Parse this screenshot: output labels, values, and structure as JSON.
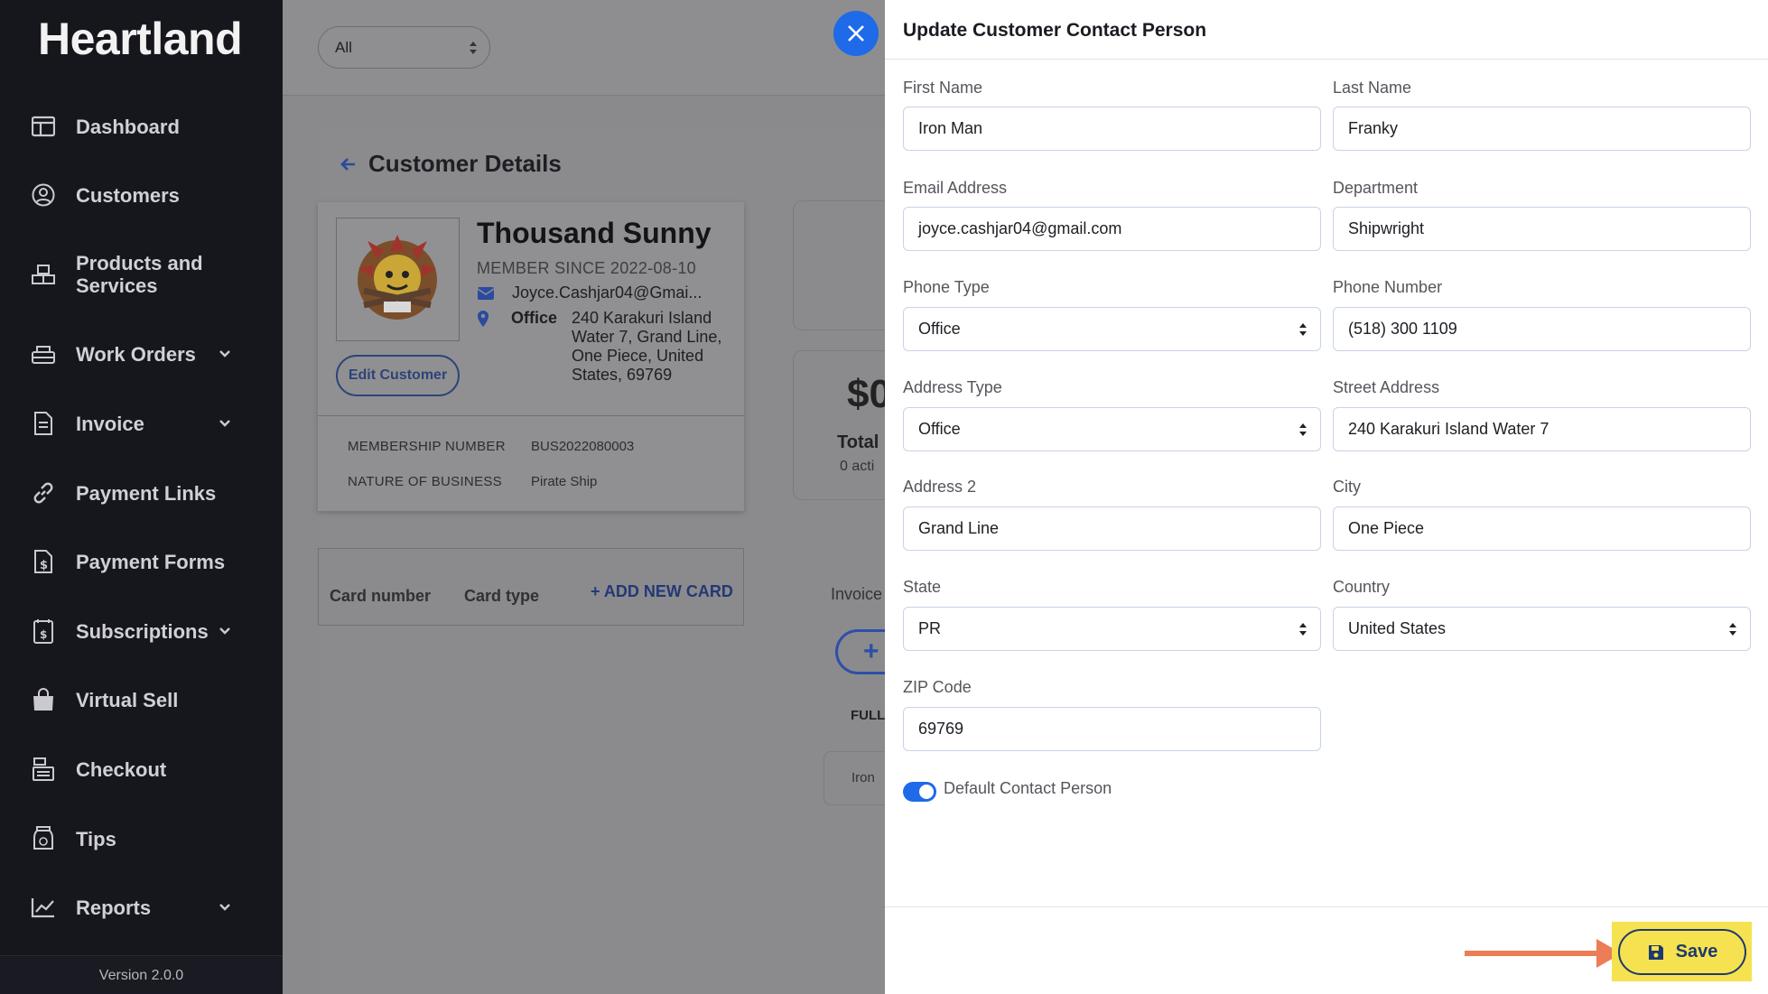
{
  "brand": "Heartland",
  "version": "Version 2.0.0",
  "sidebar": {
    "items": [
      {
        "label": "Dashboard",
        "icon": "dashboard-icon"
      },
      {
        "label": "Customers",
        "icon": "user-icon"
      },
      {
        "label": "Products and Services",
        "icon": "boxes-icon"
      },
      {
        "label": "Work Orders",
        "icon": "work-orders-icon"
      },
      {
        "label": "Invoice",
        "icon": "invoice-icon"
      },
      {
        "label": "Payment Links",
        "icon": "link-icon"
      },
      {
        "label": "Payment Forms",
        "icon": "payment-form-icon"
      },
      {
        "label": "Subscriptions",
        "icon": "subscriptions-icon"
      },
      {
        "label": "Virtual Sell",
        "icon": "bag-icon"
      },
      {
        "label": "Checkout",
        "icon": "register-icon"
      },
      {
        "label": "Tips",
        "icon": "tip-jar-icon"
      },
      {
        "label": "Reports",
        "icon": "chart-icon"
      }
    ]
  },
  "topbar": {
    "filter_value": "All"
  },
  "customer": {
    "page_title": "Customer Details",
    "name": "Thousand Sunny",
    "member_since": "MEMBER SINCE 2022-08-10",
    "email": "Joyce.Cashjar04@Gmai...",
    "address_label": "Office",
    "address": "240 Karakuri Island Water 7, Grand Line, One Piece, United States, 69769",
    "edit_label": "Edit Customer",
    "membership_label": "MEMBERSHIP NUMBER",
    "membership_value": "BUS2022080003",
    "nature_label": "NATURE OF BUSINESS",
    "nature_value": "Pirate Ship"
  },
  "cards": {
    "col_number": "Card number",
    "col_type": "Card type",
    "add_label": "+ ADD NEW CARD"
  },
  "background": {
    "dollar": "$0",
    "total": "Total",
    "active": "0 acti",
    "invoice_tab": "Invoice",
    "plus": "+",
    "full": "FULL",
    "iron": "Iron"
  },
  "modal": {
    "title": "Update Customer Contact Person",
    "first_name_label": "First Name",
    "first_name": "Iron Man",
    "last_name_label": "Last Name",
    "last_name": "Franky",
    "email_label": "Email Address",
    "email": "joyce.cashjar04@gmail.com",
    "department_label": "Department",
    "department": "Shipwright",
    "phone_type_label": "Phone Type",
    "phone_type": "Office",
    "phone_number_label": "Phone Number",
    "phone_number": "(518) 300 1109",
    "address_type_label": "Address Type",
    "address_type": "Office",
    "street_label": "Street Address",
    "street": "240 Karakuri Island Water 7",
    "address2_label": "Address 2",
    "address2": "Grand Line",
    "city_label": "City",
    "city": "One Piece",
    "state_label": "State",
    "state": "PR",
    "country_label": "Country",
    "country": "United States",
    "zip_label": "ZIP Code",
    "zip": "69769",
    "default_label": "Default Contact Person",
    "default_on": true,
    "save_label": "Save"
  },
  "colors": {
    "accent": "#1e6ae8",
    "sidebar_bg": "#16161d",
    "highlight": "#f6e250",
    "arrow": "#ec7d56"
  }
}
